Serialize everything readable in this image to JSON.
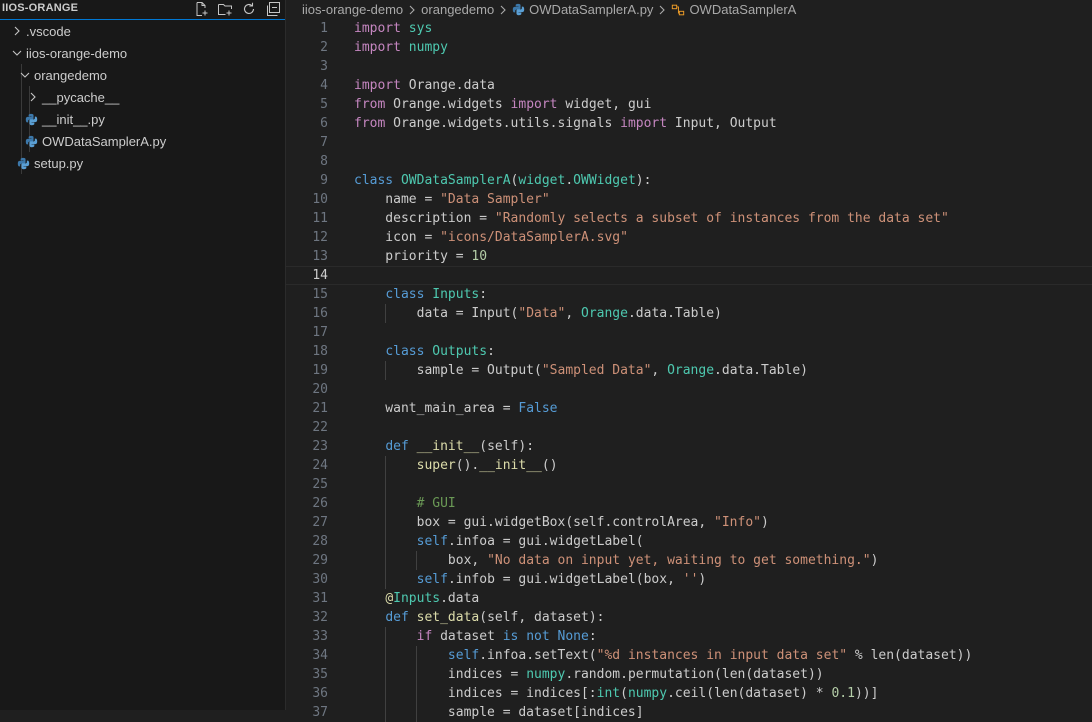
{
  "sidebar": {
    "title": "IIOS-ORANGE",
    "actions": [
      {
        "name": "new-file-icon"
      },
      {
        "name": "new-folder-icon"
      },
      {
        "name": "refresh-icon"
      },
      {
        "name": "collapse-all-icon"
      }
    ],
    "items": [
      {
        "label": ".vscode",
        "depth": 0,
        "kind": "folder",
        "expanded": false
      },
      {
        "label": "iios-orange-demo",
        "depth": 0,
        "kind": "folder",
        "expanded": true
      },
      {
        "label": "orangedemo",
        "depth": 1,
        "kind": "folder",
        "expanded": true
      },
      {
        "label": "__pycache__",
        "depth": 2,
        "kind": "folder",
        "expanded": false
      },
      {
        "label": "__init__.py",
        "depth": 2,
        "kind": "python-file"
      },
      {
        "label": "OWDataSamplerA.py",
        "depth": 2,
        "kind": "python-file"
      },
      {
        "label": "setup.py",
        "depth": 1,
        "kind": "python-file"
      }
    ]
  },
  "breadcrumb": [
    "iios-orange-demo",
    "orangedemo",
    "OWDataSamplerA.py",
    "OWDataSamplerA"
  ],
  "editor": {
    "current_line": 14,
    "lines": [
      {
        "n": "1",
        "i": 0,
        "t": [
          [
            "kc",
            "import"
          ],
          [
            "txt",
            " "
          ],
          [
            "cls",
            "sys"
          ]
        ]
      },
      {
        "n": "2",
        "i": 0,
        "t": [
          [
            "kc",
            "import"
          ],
          [
            "txt",
            " "
          ],
          [
            "cls",
            "numpy"
          ]
        ]
      },
      {
        "n": "3",
        "i": 0,
        "t": []
      },
      {
        "n": "4",
        "i": 0,
        "t": [
          [
            "kc",
            "import"
          ],
          [
            "txt",
            " Orange.data"
          ]
        ]
      },
      {
        "n": "5",
        "i": 0,
        "t": [
          [
            "kc",
            "from"
          ],
          [
            "txt",
            " Orange.widgets "
          ],
          [
            "kc",
            "import"
          ],
          [
            "txt",
            " widget, gui"
          ]
        ]
      },
      {
        "n": "6",
        "i": 0,
        "t": [
          [
            "kc",
            "from"
          ],
          [
            "txt",
            " Orange.widgets.utils.signals "
          ],
          [
            "kc",
            "import"
          ],
          [
            "txt",
            " Input, Output"
          ]
        ]
      },
      {
        "n": "7",
        "i": 0,
        "t": []
      },
      {
        "n": "8",
        "i": 0,
        "t": []
      },
      {
        "n": "9",
        "i": 0,
        "t": [
          [
            "kw",
            "class"
          ],
          [
            "txt",
            " "
          ],
          [
            "cls",
            "OWDataSamplerA"
          ],
          [
            "txt",
            "("
          ],
          [
            "cls",
            "widget"
          ],
          [
            "txt",
            "."
          ],
          [
            "cls",
            "OWWidget"
          ],
          [
            "txt",
            "):"
          ]
        ]
      },
      {
        "n": "10",
        "i": 1,
        "t": [
          [
            "txt",
            "    name = "
          ],
          [
            "str",
            "\"Data Sampler\""
          ]
        ]
      },
      {
        "n": "11",
        "i": 1,
        "t": [
          [
            "txt",
            "    description = "
          ],
          [
            "str",
            "\"Randomly selects a subset of instances from the data set\""
          ]
        ]
      },
      {
        "n": "12",
        "i": 1,
        "t": [
          [
            "txt",
            "    icon = "
          ],
          [
            "str",
            "\"icons/DataSamplerA.svg\""
          ]
        ]
      },
      {
        "n": "13",
        "i": 1,
        "t": [
          [
            "txt",
            "    priority = "
          ],
          [
            "num",
            "10"
          ]
        ]
      },
      {
        "n": "14",
        "i": 1,
        "t": []
      },
      {
        "n": "15",
        "i": 1,
        "t": [
          [
            "txt",
            "    "
          ],
          [
            "kw",
            "class"
          ],
          [
            "txt",
            " "
          ],
          [
            "cls",
            "Inputs"
          ],
          [
            "txt",
            ":"
          ]
        ]
      },
      {
        "n": "16",
        "i": 2,
        "t": [
          [
            "txt",
            "        data = Input("
          ],
          [
            "str",
            "\"Data\""
          ],
          [
            "txt",
            ", "
          ],
          [
            "cls",
            "Orange"
          ],
          [
            "txt",
            ".data.Table)"
          ]
        ]
      },
      {
        "n": "17",
        "i": 1,
        "t": []
      },
      {
        "n": "18",
        "i": 1,
        "t": [
          [
            "txt",
            "    "
          ],
          [
            "kw",
            "class"
          ],
          [
            "txt",
            " "
          ],
          [
            "cls",
            "Outputs"
          ],
          [
            "txt",
            ":"
          ]
        ]
      },
      {
        "n": "19",
        "i": 2,
        "t": [
          [
            "txt",
            "        sample = Output("
          ],
          [
            "str",
            "\"Sampled Data\""
          ],
          [
            "txt",
            ", "
          ],
          [
            "cls",
            "Orange"
          ],
          [
            "txt",
            ".data.Table)"
          ]
        ]
      },
      {
        "n": "20",
        "i": 1,
        "t": []
      },
      {
        "n": "21",
        "i": 1,
        "t": [
          [
            "txt",
            "    want_main_area = "
          ],
          [
            "kw",
            "False"
          ]
        ]
      },
      {
        "n": "22",
        "i": 1,
        "t": []
      },
      {
        "n": "23",
        "i": 1,
        "t": [
          [
            "txt",
            "    "
          ],
          [
            "kw",
            "def"
          ],
          [
            "txt",
            " "
          ],
          [
            "fn",
            "__init__"
          ],
          [
            "txt",
            "(self):"
          ]
        ]
      },
      {
        "n": "24",
        "i": 2,
        "t": [
          [
            "txt",
            "        "
          ],
          [
            "fn",
            "super"
          ],
          [
            "txt",
            "()."
          ],
          [
            "fn",
            "__init__"
          ],
          [
            "txt",
            "()"
          ]
        ]
      },
      {
        "n": "25",
        "i": 2,
        "t": []
      },
      {
        "n": "26",
        "i": 2,
        "t": [
          [
            "txt",
            "        "
          ],
          [
            "cmt",
            "# GUI"
          ]
        ]
      },
      {
        "n": "27",
        "i": 2,
        "t": [
          [
            "txt",
            "        box = gui.widgetBox(self.controlArea, "
          ],
          [
            "str",
            "\"Info\""
          ],
          [
            "txt",
            ")"
          ]
        ]
      },
      {
        "n": "28",
        "i": 2,
        "t": [
          [
            "txt",
            "        "
          ],
          [
            "kw",
            "self"
          ],
          [
            "txt",
            ".infoa = gui.widgetLabel("
          ]
        ]
      },
      {
        "n": "29",
        "i": 3,
        "t": [
          [
            "txt",
            "            box, "
          ],
          [
            "str",
            "\"No data on input yet, waiting to get something.\""
          ],
          [
            "txt",
            ")"
          ]
        ]
      },
      {
        "n": "30",
        "i": 2,
        "t": [
          [
            "txt",
            "        "
          ],
          [
            "kw",
            "self"
          ],
          [
            "txt",
            ".infob = gui.widgetLabel(box, "
          ],
          [
            "str",
            "''"
          ],
          [
            "txt",
            ")"
          ]
        ]
      },
      {
        "n": "31",
        "i": 1,
        "t": [
          [
            "txt",
            "    "
          ],
          [
            "dec",
            "@"
          ],
          [
            "cls",
            "Inputs"
          ],
          [
            "txt",
            ".data"
          ]
        ]
      },
      {
        "n": "32",
        "i": 1,
        "t": [
          [
            "txt",
            "    "
          ],
          [
            "kw",
            "def"
          ],
          [
            "txt",
            " "
          ],
          [
            "fn",
            "set_data"
          ],
          [
            "txt",
            "(self, dataset):"
          ]
        ]
      },
      {
        "n": "33",
        "i": 2,
        "t": [
          [
            "txt",
            "        "
          ],
          [
            "kc",
            "if"
          ],
          [
            "txt",
            " dataset "
          ],
          [
            "kw",
            "is not None"
          ],
          [
            "txt",
            ":"
          ]
        ]
      },
      {
        "n": "34",
        "i": 3,
        "t": [
          [
            "txt",
            "            "
          ],
          [
            "kw",
            "self"
          ],
          [
            "txt",
            ".infoa.setText("
          ],
          [
            "str",
            "\"%d instances in input data set\""
          ],
          [
            "txt",
            " % len(dataset))"
          ]
        ]
      },
      {
        "n": "35",
        "i": 3,
        "t": [
          [
            "txt",
            "            indices = "
          ],
          [
            "cls",
            "numpy"
          ],
          [
            "txt",
            ".random.permutation(len(dataset))"
          ]
        ]
      },
      {
        "n": "36",
        "i": 3,
        "t": [
          [
            "txt",
            "            indices = indices[:"
          ],
          [
            "cls",
            "int"
          ],
          [
            "txt",
            "("
          ],
          [
            "cls",
            "numpy"
          ],
          [
            "txt",
            ".ceil(len(dataset) * "
          ],
          [
            "num",
            "0.1"
          ],
          [
            "txt",
            "))]"
          ]
        ]
      },
      {
        "n": "37",
        "i": 3,
        "t": [
          [
            "txt",
            "            sample = dataset[indices]"
          ]
        ]
      }
    ]
  },
  "colors": {
    "background": "#1f1f1f",
    "sidebar_background": "#181818",
    "accent": "#0078d4",
    "keyword": "#569cd6",
    "control_keyword": "#c586c0",
    "string": "#ce9178",
    "number": "#b5cea8",
    "class": "#4ec9b0",
    "function": "#dcdcaa",
    "comment": "#6a9955"
  }
}
